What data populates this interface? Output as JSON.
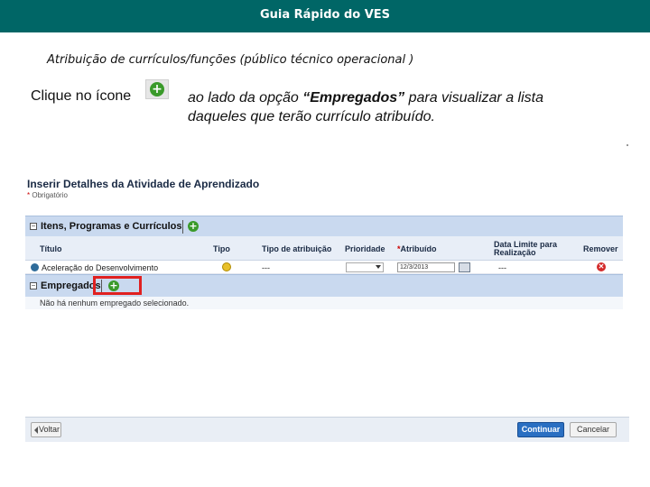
{
  "header": {
    "title": "Guia Rápido do VES"
  },
  "subtitle": "Atribuição de currículos/funções (público técnico operacional )",
  "instruction": {
    "part1": "Clique no ícone",
    "part2": "ao lado da opção ",
    "highlight": "“Empregados”",
    "part3": " para visualizar a lista daqueles que terão currículo atribuído."
  },
  "panel": {
    "title": "Inserir Detalhes da Atividade de Aprendizado",
    "required_marker": "*",
    "required_label": "Obrigatório",
    "sections": {
      "items": {
        "toggle": "⊟",
        "label": "Itens, Programas e Currículos"
      },
      "employees": {
        "toggle": "⊟",
        "label": "Empregados",
        "empty_message": "Não há nenhum empregado selecionado."
      }
    },
    "columns": {
      "title": "Título",
      "type": "Tipo",
      "assignment_type": "Tipo de atribuição",
      "priority": "Prioridade",
      "assigned_marker": "*",
      "assigned": "Atribuído",
      "due_date_line1": "Data Limite para",
      "due_date_line2": "Realização",
      "remove": "Remover"
    },
    "row": {
      "title": "Aceleração do Desenvolvimento",
      "assignment_type": "---",
      "priority": "",
      "assigned_date": "12/3/2013",
      "due_date": "---"
    }
  },
  "footer": {
    "back": "Voltar",
    "continue": "Continuar",
    "cancel": "Cancelar"
  },
  "icons": {
    "plus": "plus-circle-icon",
    "type": "course-icon",
    "calendar": "calendar-icon",
    "remove": "remove-icon",
    "globe": "globe-icon"
  },
  "colors": {
    "header_bg": "#006666",
    "section_bar": "#c9d9ef",
    "highlight_box": "#e02020",
    "primary_button": "#2a6fc2",
    "plus_green": "#3a9a2a"
  }
}
